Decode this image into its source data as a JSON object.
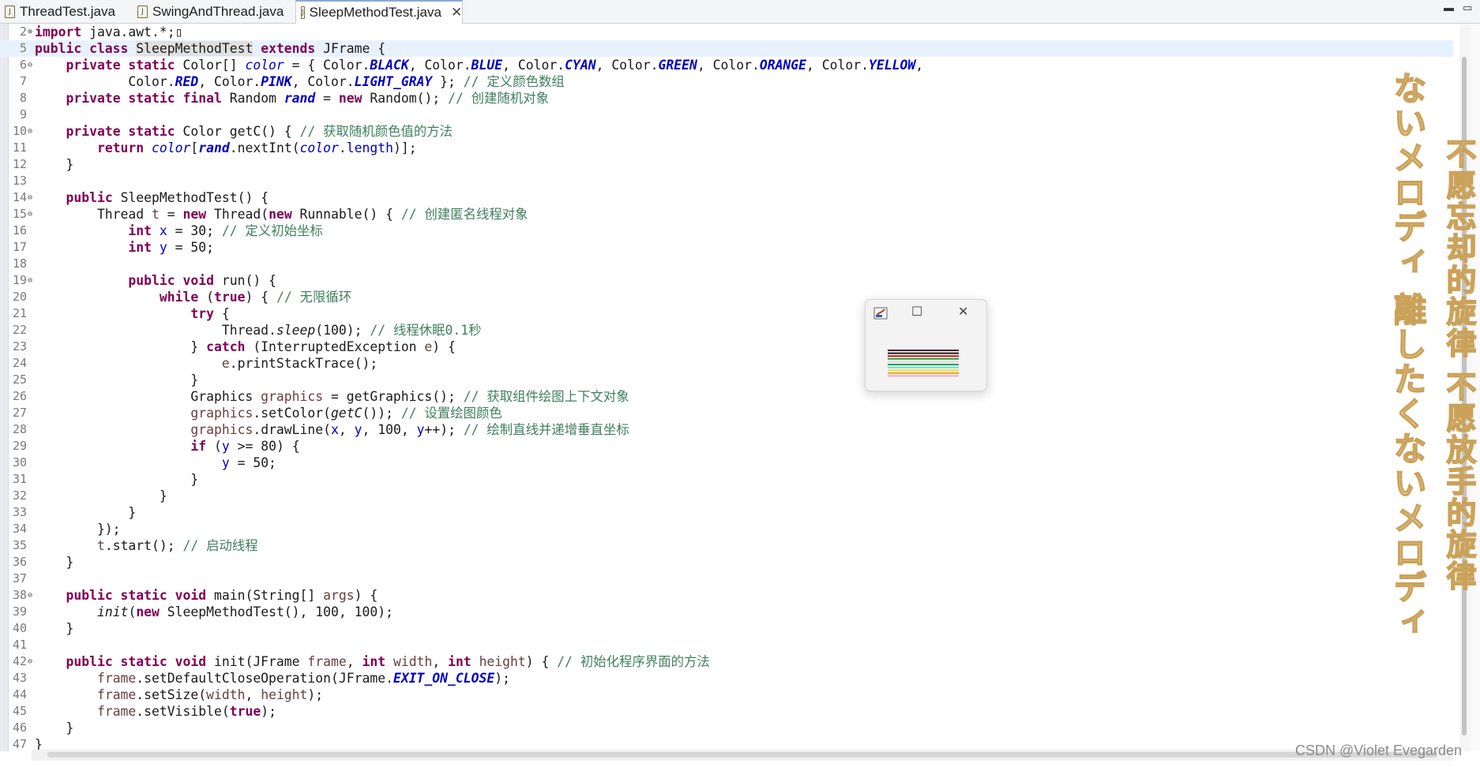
{
  "tabs": [
    {
      "label": "ThreadTest.java",
      "active": false
    },
    {
      "label": "SwingAndThread.java",
      "active": false
    },
    {
      "label": "SleepMethodTest.java",
      "active": true
    }
  ],
  "tab_close_glyph": "✕",
  "window_controls": {
    "minimize": "▬",
    "maximize": "▭"
  },
  "code_lines": [
    {
      "n": "2",
      "fold": "⊕",
      "html": "<span class=\"kw\">import</span> java.awt.*;▯"
    },
    {
      "n": "5",
      "fold": "",
      "current": true,
      "html": "<span class=\"kw\">public class</span> <span class=\"hl\">SleepMethodTest</span> <span class=\"kw\">extends</span> JFrame {"
    },
    {
      "n": "6",
      "fold": "⊖",
      "html": "    <span class=\"kw\">private static</span> Color[] <span class=\"sfld\">color</span> = { Color.<span class=\"sfb\">BLACK</span>, Color.<span class=\"sfb\">BLUE</span>, Color.<span class=\"sfb\">CYAN</span>, Color.<span class=\"sfb\">GREEN</span>, Color.<span class=\"sfb\">ORANGE</span>, Color.<span class=\"sfb\">YELLOW</span>,"
    },
    {
      "n": "7",
      "fold": "",
      "html": "            Color.<span class=\"sfb\">RED</span>, Color.<span class=\"sfb\">PINK</span>, Color.<span class=\"sfb\">LIGHT_GRAY</span> }; <span class=\"cm\">// 定义颜色数组</span>"
    },
    {
      "n": "8",
      "fold": "",
      "html": "    <span class=\"kw\">private static final</span> Random <span class=\"sfb\" style=\"font-style:italic\">rand</span> = <span class=\"kw\">new</span> Random(); <span class=\"cm\">// 创建随机对象</span>"
    },
    {
      "n": "9",
      "fold": "",
      "html": ""
    },
    {
      "n": "10",
      "fold": "⊖",
      "html": "    <span class=\"kw\">private static</span> Color getC() { <span class=\"cm\">// 获取随机颜色值的方法</span>"
    },
    {
      "n": "11",
      "fold": "",
      "html": "        <span class=\"kw\">return</span> <span class=\"sfld\">color</span>[<span class=\"sfb\">rand</span>.nextInt(<span class=\"sfld\">color</span>.<span class=\"fld\">length</span>)];"
    },
    {
      "n": "12",
      "fold": "",
      "html": "    }"
    },
    {
      "n": "13",
      "fold": "",
      "html": ""
    },
    {
      "n": "14",
      "fold": "⊖",
      "html": "    <span class=\"kw\">public</span> SleepMethodTest() {"
    },
    {
      "n": "15",
      "fold": "⊖",
      "html": "        Thread <span class=\"var\">t</span> = <span class=\"kw\">new</span> Thread(<span class=\"kw\">new</span> Runnable() { <span class=\"cm\">// 创建匿名线程对象</span>"
    },
    {
      "n": "16",
      "fold": "",
      "html": "            <span class=\"kw\">int</span> <span class=\"fld\">x</span> = 30; <span class=\"cm\">// 定义初始坐标</span>"
    },
    {
      "n": "17",
      "fold": "",
      "html": "            <span class=\"kw\">int</span> <span class=\"fld\">y</span> = 50;"
    },
    {
      "n": "18",
      "fold": "",
      "html": ""
    },
    {
      "n": "19",
      "fold": "⊖",
      "html": "            <span class=\"kw\">public void</span> run() {"
    },
    {
      "n": "20",
      "fold": "",
      "html": "                <span class=\"kw\">while</span> (<span class=\"kw\">true</span>) { <span class=\"cm\">// 无限循环</span>"
    },
    {
      "n": "21",
      "fold": "",
      "html": "                    <span class=\"kw\">try</span> {"
    },
    {
      "n": "22",
      "fold": "",
      "html": "                        Thread.<span class=\"it\">sleep</span>(100); <span class=\"cm\">// 线程休眠0.1秒</span>"
    },
    {
      "n": "23",
      "fold": "",
      "html": "                    } <span class=\"kw\">catch</span> (InterruptedException <span class=\"var\">e</span>) {"
    },
    {
      "n": "24",
      "fold": "",
      "html": "                        <span class=\"var\">e</span>.printStackTrace();"
    },
    {
      "n": "25",
      "fold": "",
      "html": "                    }"
    },
    {
      "n": "26",
      "fold": "",
      "html": "                    Graphics <span class=\"var\">graphics</span> = getGraphics(); <span class=\"cm\">// 获取组件绘图上下文对象</span>"
    },
    {
      "n": "27",
      "fold": "",
      "html": "                    <span class=\"var\">graphics</span>.setColor(<span class=\"it\">getC</span>()); <span class=\"cm\">// 设置绘图颜色</span>"
    },
    {
      "n": "28",
      "fold": "",
      "html": "                    <span class=\"var\">graphics</span>.drawLine(<span class=\"fld\">x</span>, <span class=\"fld\">y</span>, 100, <span class=\"fld\">y</span>++); <span class=\"cm\">// 绘制直线并递增垂直坐标</span>"
    },
    {
      "n": "29",
      "fold": "",
      "html": "                    <span class=\"kw\">if</span> (<span class=\"fld\">y</span> >= 80) {"
    },
    {
      "n": "30",
      "fold": "",
      "html": "                        <span class=\"fld\">y</span> = 50;"
    },
    {
      "n": "31",
      "fold": "",
      "html": "                    }"
    },
    {
      "n": "32",
      "fold": "",
      "html": "                }"
    },
    {
      "n": "33",
      "fold": "",
      "html": "            }"
    },
    {
      "n": "34",
      "fold": "",
      "html": "        });"
    },
    {
      "n": "35",
      "fold": "",
      "html": "        <span class=\"var\">t</span>.start(); <span class=\"cm\">// 启动线程</span>"
    },
    {
      "n": "36",
      "fold": "",
      "html": "    }"
    },
    {
      "n": "37",
      "fold": "",
      "html": ""
    },
    {
      "n": "38",
      "fold": "⊖",
      "html": "    <span class=\"kw\">public static void</span> main(String[] <span class=\"var\">args</span>) {"
    },
    {
      "n": "39",
      "fold": "",
      "html": "        <span class=\"it\">init</span>(<span class=\"kw\">new</span> SleepMethodTest(), 100, 100);"
    },
    {
      "n": "40",
      "fold": "",
      "html": "    }"
    },
    {
      "n": "41",
      "fold": "",
      "html": ""
    },
    {
      "n": "42",
      "fold": "⊖",
      "html": "    <span class=\"kw\">public static void</span> init(JFrame <span class=\"var\">frame</span>, <span class=\"kw\">int</span> <span class=\"var\">width</span>, <span class=\"kw\">int</span> <span class=\"var\">height</span>) { <span class=\"cm\">// 初始化程序界面的方法</span>"
    },
    {
      "n": "43",
      "fold": "",
      "html": "        <span class=\"var\">frame</span>.setDefaultCloseOperation(JFrame.<span class=\"sfb\">EXIT_ON_CLOSE</span>);"
    },
    {
      "n": "44",
      "fold": "",
      "html": "        <span class=\"var\">frame</span>.setSize(<span class=\"var\">width</span>, <span class=\"var\">height</span>);"
    },
    {
      "n": "45",
      "fold": "",
      "html": "        <span class=\"var\">frame</span>.setVisible(<span class=\"kw\">true</span>);"
    },
    {
      "n": "46",
      "fold": "",
      "html": "    }"
    },
    {
      "n": "47",
      "fold": "",
      "html": "}"
    }
  ],
  "running_window": {
    "buttons": {
      "maximize": "☐",
      "close": "✕"
    },
    "line_colors": [
      "#4a1030",
      "#1a1a1a",
      "#c01818",
      "#2f9e3a",
      "#d8d8d8",
      "#1a9e55",
      "#6bdcd8",
      "#f2e23a",
      "#f2a020",
      "#f0b0c0"
    ]
  },
  "decoration": {
    "left_column": "ないメロディ 離したくないメロディ",
    "right_column": "不愿忘却的旋律 不愿放手的旋律"
  },
  "credit": "CSDN @Violet Evegarden"
}
